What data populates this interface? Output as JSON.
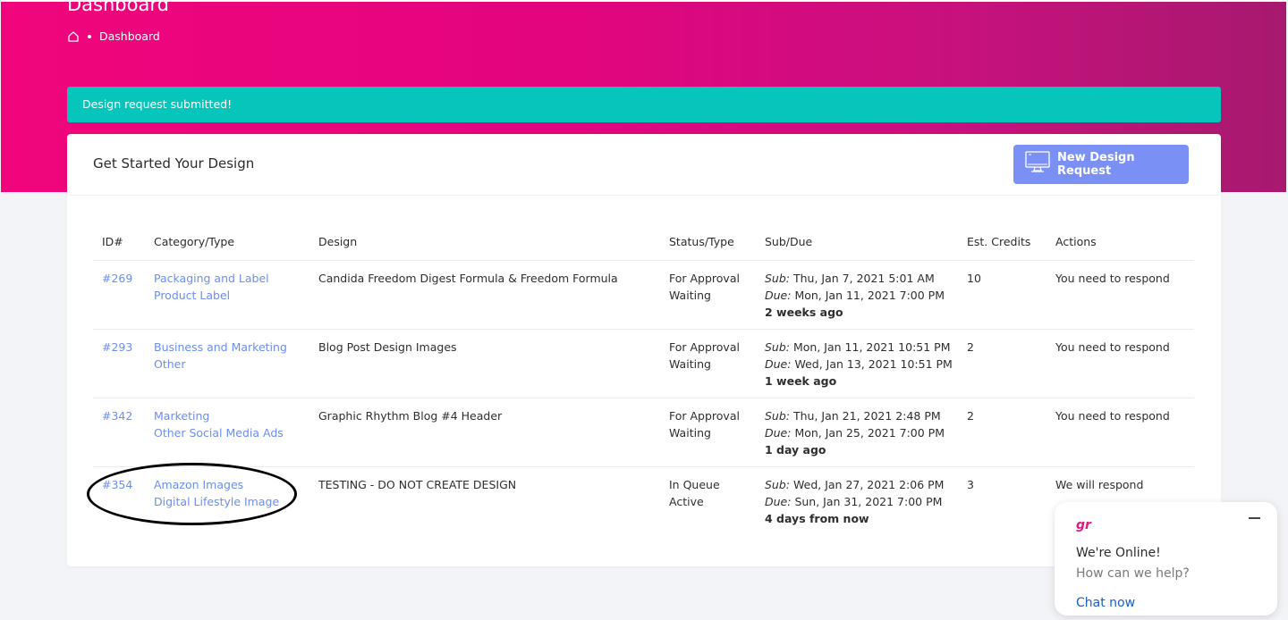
{
  "header": {
    "title": "Dashboard",
    "breadcrumb": {
      "home_icon": "home-icon",
      "current": "Dashboard"
    }
  },
  "alert": {
    "message": "Design request submitted!"
  },
  "card": {
    "title": "Get Started Your Design",
    "new_button_label": "New Design Request",
    "new_button_icon": "monitor-icon"
  },
  "table": {
    "columns": [
      "ID#",
      "Category/Type",
      "Design",
      "Status/Type",
      "Sub/Due",
      "Est. Credits",
      "Actions"
    ],
    "rows": [
      {
        "id": "#269",
        "category": "Packaging and Label",
        "type": "Product Label",
        "design": "Candida Freedom Digest Formula & Freedom Formula",
        "status": "For Approval",
        "status_type": "Waiting",
        "sub_label": "Sub:",
        "sub": "Thu, Jan 7, 2021 5:01 AM",
        "due_label": "Due:",
        "due": "Mon, Jan 11, 2021 7:00 PM",
        "relative": "2 weeks ago",
        "credits": "10",
        "action": "You need to respond"
      },
      {
        "id": "#293",
        "category": "Business and Marketing",
        "type": "Other",
        "design": "Blog Post Design Images",
        "status": "For Approval",
        "status_type": "Waiting",
        "sub_label": "Sub:",
        "sub": "Mon, Jan 11, 2021 10:51 PM",
        "due_label": "Due:",
        "due": "Wed, Jan 13, 2021 10:51 PM",
        "relative": "1 week ago",
        "credits": "2",
        "action": "You need to respond"
      },
      {
        "id": "#342",
        "category": "Marketing",
        "type": "Other Social Media Ads",
        "design": "Graphic Rhythm Blog #4 Header",
        "status": "For Approval",
        "status_type": "Waiting",
        "sub_label": "Sub:",
        "sub": "Thu, Jan 21, 2021 2:48 PM",
        "due_label": "Due:",
        "due": "Mon, Jan 25, 2021 7:00 PM",
        "relative": "1 day ago",
        "credits": "2",
        "action": "You need to respond"
      },
      {
        "id": "#354",
        "category": "Amazon Images",
        "type": "Digital Lifestyle Image",
        "design": "TESTING - DO NOT CREATE DESIGN",
        "status": "In Queue",
        "status_type": "Active",
        "sub_label": "Sub:",
        "sub": "Wed, Jan 27, 2021 2:06 PM",
        "due_label": "Due:",
        "due": "Sun, Jan 31, 2021 7:00 PM",
        "relative": "4 days from now",
        "credits": "3",
        "action": "We will respond"
      }
    ]
  },
  "chat": {
    "logo_text": "gr",
    "headline": "We're Online!",
    "subline": "How can we help?",
    "cta": "Chat now",
    "minimize_icon": "minimize-icon"
  },
  "colors": {
    "gradient_start": "#f0057c",
    "gradient_end": "#a7196f",
    "alert": "#06c6bb",
    "button": "#7b90f5",
    "link": "#6b8ef0",
    "chat_link": "#1a5dc9"
  }
}
